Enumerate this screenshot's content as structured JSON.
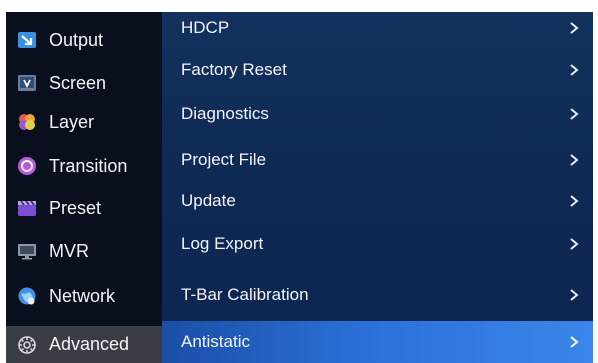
{
  "sidebar": {
    "items": [
      {
        "label": "Output",
        "icon": "output-icon"
      },
      {
        "label": "Screen",
        "icon": "screen-icon"
      },
      {
        "label": "Layer",
        "icon": "layer-icon"
      },
      {
        "label": "Transition",
        "icon": "transition-icon"
      },
      {
        "label": "Preset",
        "icon": "preset-icon"
      },
      {
        "label": "MVR",
        "icon": "mvr-icon"
      },
      {
        "label": "Network",
        "icon": "network-icon"
      },
      {
        "label": "Advanced",
        "icon": "advanced-icon",
        "active": true
      }
    ]
  },
  "menu": {
    "items": [
      {
        "label": "HDCP"
      },
      {
        "label": "Factory Reset"
      },
      {
        "label": "Diagnostics"
      },
      {
        "label": "Project File"
      },
      {
        "label": "Update"
      },
      {
        "label": "Log Export"
      },
      {
        "label": "T-Bar Calibration"
      },
      {
        "label": "Antistatic",
        "selected": true
      }
    ],
    "chevron_icon": "chevron-right-icon"
  },
  "colors": {
    "sidebar_bg": "#0a0f1d",
    "panel_bg": "#0f2b55",
    "selected_bg": "#2a6fd6",
    "active_sidebar_bg": "#3a3d45"
  }
}
